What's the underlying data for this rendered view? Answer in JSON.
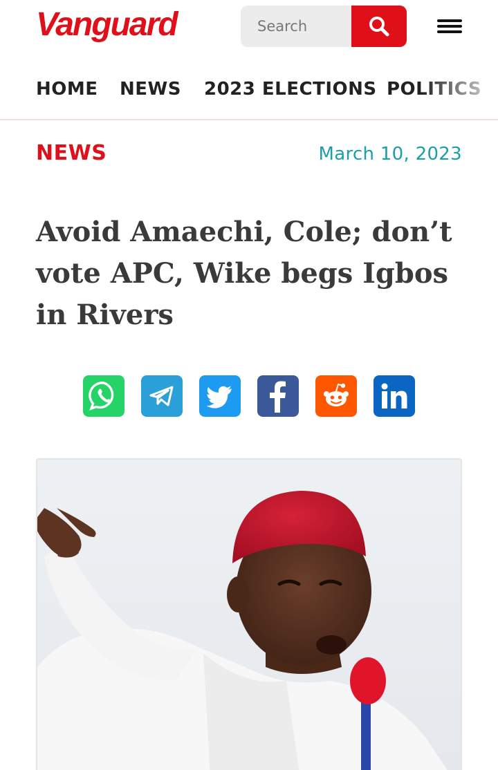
{
  "header": {
    "logo_text": "Vanguard",
    "search_placeholder": "Search",
    "brand_color": "#e0101a"
  },
  "nav": {
    "items": [
      "HOME",
      "NEWS",
      "2023 ELECTIONS",
      "POLITICS"
    ]
  },
  "article": {
    "category": "NEWS",
    "date": "March 10, 2023",
    "headline": "Avoid Amaechi, Cole; don’t vote APC, Wike begs Igbos in Rivers",
    "share": [
      {
        "icon": "whatsapp-icon",
        "color": "#25d366"
      },
      {
        "icon": "telegram-icon",
        "color": "#2b9fd8"
      },
      {
        "icon": "twitter-icon",
        "color": "#1d9bf0"
      },
      {
        "icon": "facebook-icon",
        "color": "#3b5998"
      },
      {
        "icon": "reddit-icon",
        "color": "#ff5700"
      },
      {
        "icon": "linkedin-icon",
        "color": "#0a66c2"
      }
    ],
    "accent_color": "#1b9ea8"
  }
}
